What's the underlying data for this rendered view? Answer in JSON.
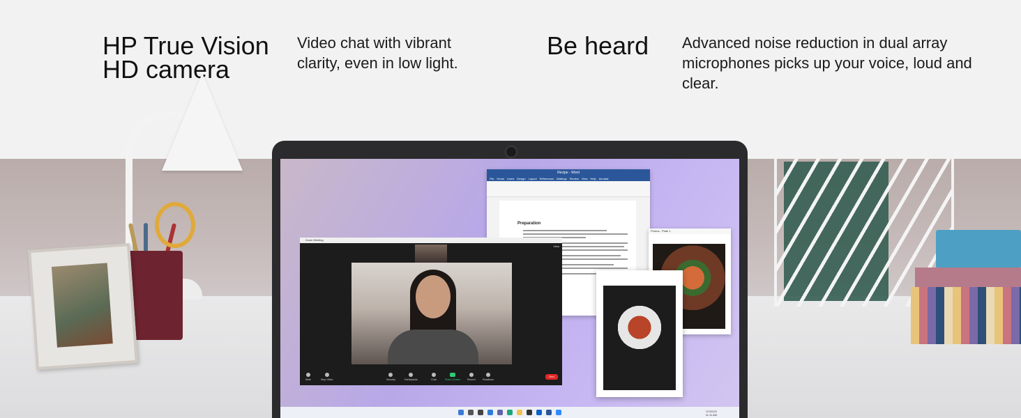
{
  "features": [
    {
      "title": "HP True Vision HD camera",
      "description": "Video chat with vibrant clarity, even in low light."
    },
    {
      "title": "Be heard",
      "description": "Advanced noise reduction in dual array microphones picks up your voice, loud and clear."
    }
  ],
  "screen": {
    "word": {
      "title": "Recipe - Word",
      "tabs": [
        "File",
        "Home",
        "Insert",
        "Design",
        "Layout",
        "References",
        "Mailings",
        "Review",
        "View",
        "Help",
        "Acrobat"
      ],
      "heading": "Preparation"
    },
    "zoom": {
      "title": "Zoom Meeting",
      "view_label": "View",
      "controls": [
        "Mute",
        "Stop Video",
        "Security",
        "Participants",
        "Chat",
        "Share Screen",
        "Record",
        "Reactions"
      ],
      "end_label": "End"
    },
    "photos": {
      "title": "Photos - Plate 1"
    },
    "taskbar": {
      "date": "07/20/22",
      "time": "11:11 AM"
    }
  },
  "colors": {
    "word_blue": "#2b579a",
    "zoom_end": "#e02828",
    "share_green": "#2ecc71"
  }
}
